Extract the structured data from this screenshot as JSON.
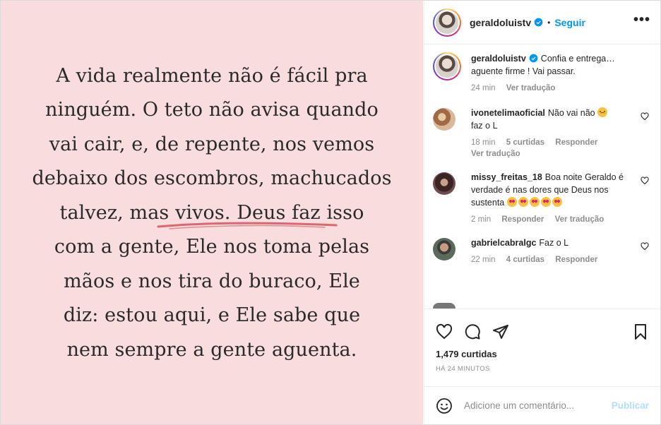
{
  "post": {
    "quote_lines": [
      "A vida realmente não é fácil pra",
      "ninguém. O teto não avisa quando",
      "vai cair, e, de repente, nos vemos",
      "debaixo dos escombros, machucados",
      "talvez, mas vivos. Deus faz isso",
      "com a gente, Ele nos toma pelas",
      "mãos e nos tira do buraco, Ele",
      "diz: estou aqui, e Ele sabe que",
      "nem sempre a gente aguenta."
    ],
    "background_color": "#f9dcde"
  },
  "header": {
    "username": "geraldoluistv",
    "separator": "•",
    "follow_label": "Seguir",
    "more_label": "•••"
  },
  "caption": {
    "username": "geraldoluistv",
    "text": "Confia e entrega… aguente firme ! Vai passar.",
    "time": "24 min",
    "translate": "Ver tradução"
  },
  "comments": [
    {
      "username": "ivonetelimaoficial",
      "text": "Não vai não",
      "emoji": "sad-face",
      "text2": "faz o L",
      "time": "18 min",
      "likes": "5 curtidas",
      "reply": "Responder",
      "translate": "Ver tradução"
    },
    {
      "username": "missy_freitas_18",
      "text": "Boa noite Geraldo é verdade é nas dores que Deus nos sustenta",
      "emoji": "heart-eyes x5",
      "time": "2 min",
      "reply": "Responder",
      "translate": "Ver tradução"
    },
    {
      "username": "gabrielcabralgc",
      "text": "Faz o L",
      "time": "22 min",
      "likes": "4 curtidas",
      "reply": "Responder"
    }
  ],
  "stats": {
    "likes": "1,479 curtidas",
    "posted": "HÁ 24 MINUTOS"
  },
  "composer": {
    "placeholder": "Adicione um comentário...",
    "publish_label": "Publicar"
  },
  "colors": {
    "accent": "#0095f6",
    "publish_disabled": "#b2dffc",
    "underline": "#d9686f"
  }
}
